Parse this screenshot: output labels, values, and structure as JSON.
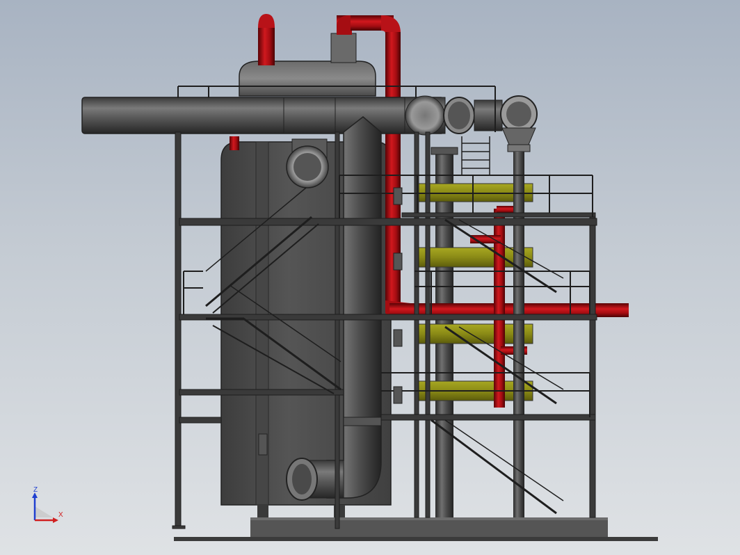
{
  "triad": {
    "z_label": "Z",
    "x_label": "X",
    "z_color": "#1f3fd0",
    "x_color": "#d02020"
  },
  "colors": {
    "background_top": "#a8b3c2",
    "background_bottom": "#dfe2e5",
    "steel": "#3a3a3a",
    "vessel": "#4a4a4a",
    "red_pipe": "#a50d12",
    "yellow_panel": "#8a8a16",
    "base": "#555555"
  }
}
